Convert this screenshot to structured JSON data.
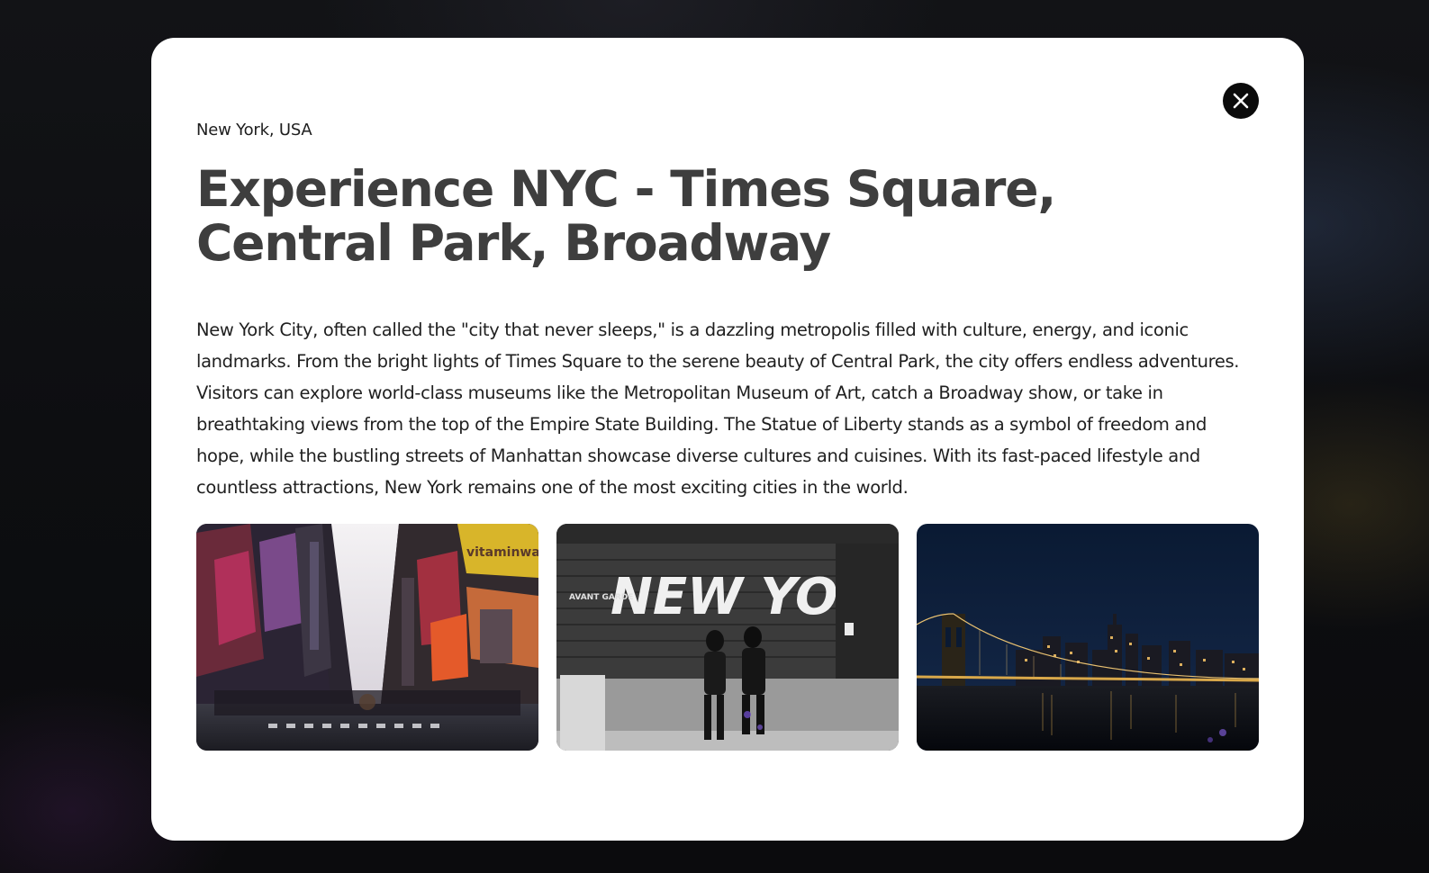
{
  "modal": {
    "location": "New York, USA",
    "title": "Experience NYC - Times Square, Central Park, Broadway",
    "description": "New York City, often called the \"city that never sleeps,\" is a dazzling metropolis filled with culture, energy, and iconic landmarks. From the bright lights of Times Square to the serene beauty of Central Park, the city offers endless adventures. Visitors can explore world-class museums like the Metropolitan Museum of Art, catch a Broadway show, or take in breathtaking views from the top of the Empire State Building. The Statue of Liberty stands as a symbol of freedom and hope, while the bustling streets of Manhattan showcase diverse cultures and cuisines. With its fast-paced lifestyle and countless attractions, New York remains one of the most exciting cities in the world.",
    "close_icon": "close-icon"
  },
  "gallery": {
    "photos": [
      {
        "subject": "times-square-street-photo",
        "sign_text": "vitaminwater zero"
      },
      {
        "subject": "new-york-graffiti-photo",
        "graffiti_text": "NEW YORK!",
        "sign_text": "AVANT GARDE"
      },
      {
        "subject": "brooklyn-bridge-night-skyline-photo"
      }
    ]
  },
  "colors": {
    "modal_background": "#ffffff",
    "title_text": "#3e3e3e",
    "body_text": "#1f1f1f",
    "close_button": "#0b0b0b",
    "backdrop": "#0d0e11"
  }
}
